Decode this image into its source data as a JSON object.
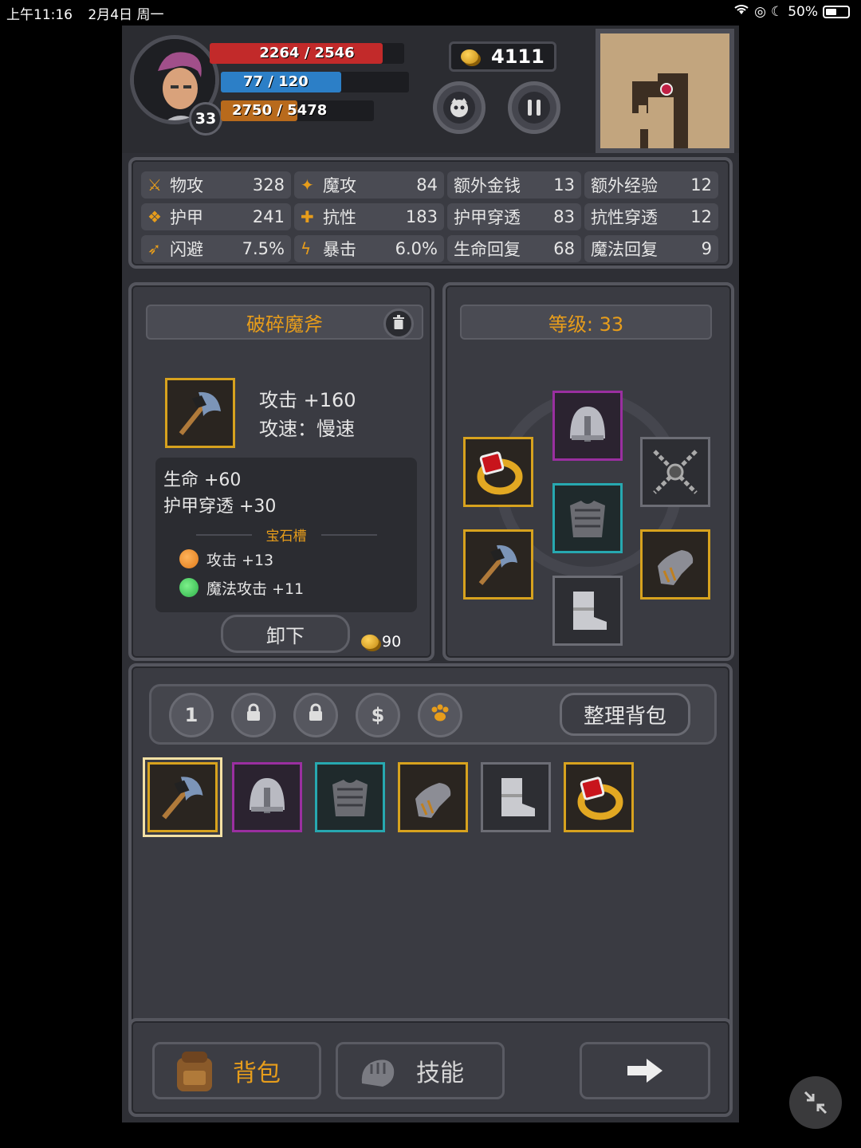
{
  "status_bar": {
    "time": "上午11:16",
    "date": "2月4日 周一",
    "battery": "50%"
  },
  "player": {
    "level": "33",
    "hp": {
      "text": "2264 / 2546",
      "current": 2264,
      "max": 2546,
      "color": "#c22a2a"
    },
    "mp": {
      "text": "77 / 120",
      "current": 77,
      "max": 120,
      "color": "#2c7fc7"
    },
    "xp": {
      "text": "2750 / 5478",
      "current": 2750,
      "max": 5478,
      "color": "#b86a1c"
    }
  },
  "gold": "4111",
  "stats": [
    {
      "icon": "sword-icon",
      "label": "物攻",
      "value": "328"
    },
    {
      "icon": "magic-boot-icon",
      "label": "魔攻",
      "value": "84"
    },
    {
      "icon": "",
      "label": "额外金钱",
      "value": "13"
    },
    {
      "icon": "",
      "label": "额外经验",
      "value": "12"
    },
    {
      "icon": "paw-icon",
      "label": "护甲",
      "value": "241"
    },
    {
      "icon": "resist-icon",
      "label": "抗性",
      "value": "183"
    },
    {
      "icon": "",
      "label": "护甲穿透",
      "value": "83"
    },
    {
      "icon": "",
      "label": "抗性穿透",
      "value": "12"
    },
    {
      "icon": "running-icon",
      "label": "闪避",
      "value": "7.5%"
    },
    {
      "icon": "lightning-icon",
      "label": "暴击",
      "value": "6.0%"
    },
    {
      "icon": "",
      "label": "生命回复",
      "value": "68"
    },
    {
      "icon": "",
      "label": "魔法回复",
      "value": "9"
    }
  ],
  "item_detail": {
    "name": "破碎魔斧",
    "attack": "攻击 +160",
    "speed": "攻速：慢速",
    "bonuses": [
      "生命 +60",
      "护甲穿透 +30"
    ],
    "gem_header": "宝石槽",
    "gems": [
      {
        "text": "攻击 +13",
        "color": "#e07a1a"
      },
      {
        "text": "魔法攻击 +11",
        "color": "#2fb14a"
      }
    ],
    "unequip_label": "卸下",
    "cost": "90"
  },
  "equipment": {
    "level_label": "等级: 33"
  },
  "inventory": {
    "tab_1": "1",
    "sort_label": "整理背包",
    "items": [
      {
        "name": "axe",
        "rarity": "gold"
      },
      {
        "name": "helmet",
        "rarity": "purple"
      },
      {
        "name": "chest-armor",
        "rarity": "teal"
      },
      {
        "name": "gauntlet",
        "rarity": "gold"
      },
      {
        "name": "boots",
        "rarity": "grey"
      },
      {
        "name": "ring",
        "rarity": "gold"
      }
    ]
  },
  "nav": {
    "bag": "背包",
    "skills": "技能"
  },
  "colors": {
    "accent": "#e79d1b",
    "panel": "#3a3b42"
  }
}
